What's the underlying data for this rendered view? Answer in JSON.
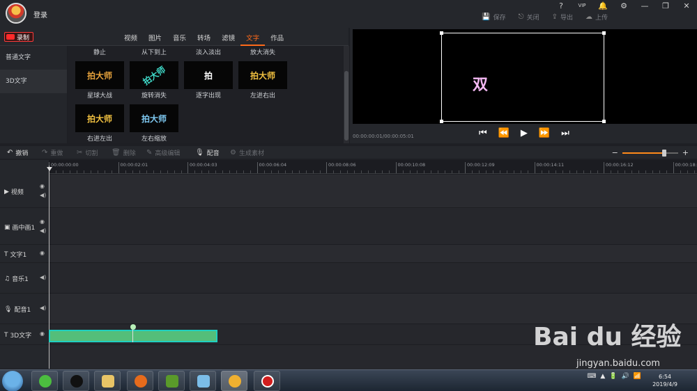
{
  "titlebar": {
    "login_label": "登录",
    "window_icons": [
      "?",
      "VIP",
      "🔔",
      "⚙",
      "—",
      "❐",
      "✕"
    ],
    "actions": [
      {
        "icon": "💾",
        "label": "保存"
      },
      {
        "icon": "⎋",
        "label": "关闭"
      },
      {
        "icon": "⇪",
        "label": "导出"
      },
      {
        "icon": "☁",
        "label": "上传"
      }
    ]
  },
  "record_label": "录制",
  "tabs": [
    {
      "label": "视频",
      "active": false
    },
    {
      "label": "图片",
      "active": false
    },
    {
      "label": "音乐",
      "active": false
    },
    {
      "label": "转场",
      "active": false
    },
    {
      "label": "滤镜",
      "active": false
    },
    {
      "label": "文字",
      "active": true
    },
    {
      "label": "作品",
      "active": false
    }
  ],
  "categories": [
    {
      "label": "普通文字",
      "active": false
    },
    {
      "label": "3D文字",
      "active": true
    }
  ],
  "effects_top_labels": [
    "静止",
    "从下到上",
    "淡入淡出",
    "放大消失"
  ],
  "effects": [
    {
      "label": "星球大战",
      "thumb_text": "拍大师",
      "thumb_color": "#e6a23c"
    },
    {
      "label": "旋转消失",
      "thumb_text": "拍大师",
      "thumb_color": "#3fd9c8"
    },
    {
      "label": "逐字出现",
      "thumb_text": "拍",
      "thumb_color": "#ffffff"
    },
    {
      "label": "左进右出",
      "thumb_text": "拍大师",
      "thumb_color": "#f0c040"
    },
    {
      "label": "右进左出",
      "thumb_text": "拍大师",
      "thumb_color": "#f0c040"
    },
    {
      "label": "左右缩放",
      "thumb_text": "拍大师",
      "thumb_color": "#7ec8f0"
    }
  ],
  "preview": {
    "text": "双",
    "timecode": "00:00:00:01/00:00:05:01"
  },
  "playback_controls": [
    "⏮",
    "⏪",
    "▶",
    "⏩",
    "⏭"
  ],
  "toolbar": [
    {
      "icon": "↶",
      "label": "撤销",
      "enabled": true
    },
    {
      "icon": "↷",
      "label": "重做",
      "enabled": false
    },
    {
      "icon": "✂",
      "label": "切割",
      "enabled": false
    },
    {
      "icon": "🗑",
      "label": "删除",
      "enabled": false
    },
    {
      "icon": "✎",
      "label": "高级编辑",
      "enabled": false
    },
    {
      "icon": "🎙",
      "label": "配音",
      "enabled": true
    },
    {
      "icon": "⚙",
      "label": "生成素材",
      "enabled": false
    }
  ],
  "zoom": {
    "minus": "−",
    "plus": "+",
    "level": 0.75
  },
  "ruler_ticks": [
    "00:00:00:00",
    "00:00:02:01",
    "00:00:04:03",
    "00:00:06:04",
    "00:00:08:06",
    "00:00:10:08",
    "00:00:12:09",
    "00:00:14:11",
    "00:00:16:12",
    "00:00:18:"
  ],
  "tracks": [
    {
      "name": "视频",
      "icon": "▶",
      "eye": true,
      "sound": true
    },
    {
      "name": "画中画1",
      "icon": "▣",
      "eye": true,
      "sound": true
    },
    {
      "name": "文字1",
      "icon": "T",
      "eye": true,
      "sound": false
    },
    {
      "name": "音乐1",
      "icon": "♫",
      "eye": false,
      "sound": true
    },
    {
      "name": "配音1",
      "icon": "🎙",
      "eye": false,
      "sound": true
    },
    {
      "name": "3D文字",
      "icon": "T",
      "eye": true,
      "sound": false
    }
  ],
  "watermark": {
    "logo": "Bai du 经验",
    "url": "jingyan.baidu.com"
  },
  "taskbar": {
    "time": "6:54",
    "date": "2019/4/9",
    "tray_icons": [
      "⌨",
      "▲",
      "🔋",
      "🔊",
      "📶"
    ]
  }
}
